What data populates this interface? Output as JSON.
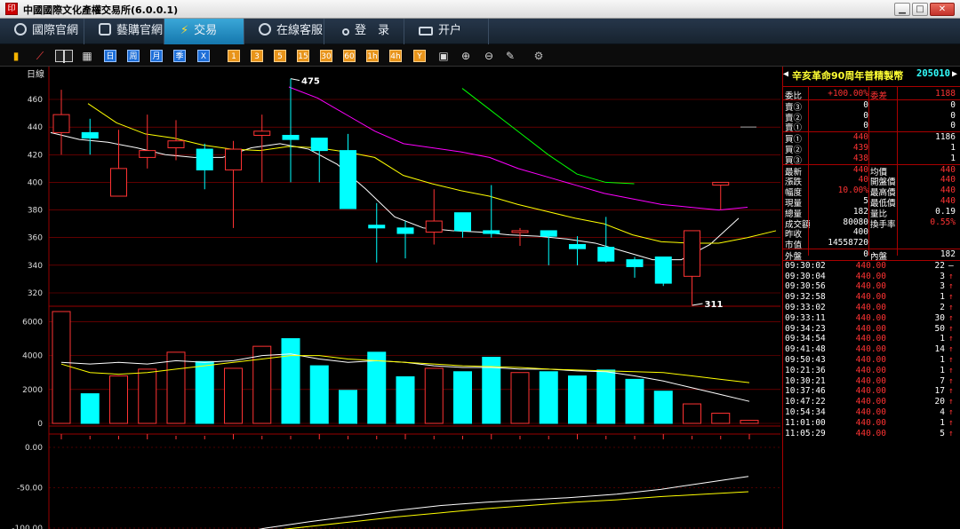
{
  "window": {
    "title": "中國國際文化產權交易所(6.0.0.1)",
    "app_icon": "seal-icon",
    "minimize": "▁",
    "maximize": "□",
    "close": "✕"
  },
  "nav": {
    "tabs": [
      {
        "label": "國際官網",
        "icon": "globe-icon"
      },
      {
        "label": "藝購官網",
        "icon": "link-icon"
      },
      {
        "label": "交易",
        "icon": "bolt-icon",
        "active": true
      },
      {
        "label": "在線客服",
        "icon": "chat-icon"
      },
      {
        "label": "登　录",
        "icon": "user-icon"
      },
      {
        "label": "开户",
        "icon": "card-icon"
      }
    ]
  },
  "toolbar": {
    "period_buttons": [
      "日",
      "周",
      "月",
      "季",
      "X"
    ],
    "minute_buttons": [
      "1",
      "3",
      "5",
      "15",
      "30",
      "60",
      "1h",
      "4h",
      "Y"
    ]
  },
  "chart": {
    "period_label": "日線",
    "colors": {
      "up": "#ff3333",
      "down": "#00ffff",
      "ma5": "#ffffff",
      "ma10": "#ffff00",
      "ma20": "#ff00ff",
      "ma60": "#00ff00",
      "grid": "#990000",
      "axis_text": "#dddddd"
    },
    "price_axis": [
      460,
      440,
      420,
      400,
      380,
      360,
      340,
      320
    ],
    "volume_axis": [
      6000,
      4000,
      2000,
      0
    ],
    "indicator_axis": [
      "0.00",
      "-50.00",
      "-100.00"
    ],
    "high_label": "475",
    "low_label": "311"
  },
  "chart_data": {
    "type": "candlestick",
    "ylim": [
      310,
      475
    ],
    "candles": [
      {
        "o": 436,
        "c": 449,
        "h": 467,
        "l": 420
      },
      {
        "o": 436,
        "c": 432,
        "h": 446,
        "l": 420
      },
      {
        "o": 390,
        "c": 410,
        "h": 438,
        "l": 390
      },
      {
        "o": 418,
        "c": 423,
        "h": 449,
        "l": 410
      },
      {
        "o": 425,
        "c": 430,
        "h": 445,
        "l": 416
      },
      {
        "o": 424,
        "c": 409,
        "h": 428,
        "l": 395
      },
      {
        "o": 409,
        "c": 424,
        "h": 430,
        "l": 367
      },
      {
        "o": 434,
        "c": 437,
        "h": 449,
        "l": 400
      },
      {
        "o": 434,
        "c": 431,
        "h": 475,
        "l": 400
      },
      {
        "o": 432,
        "c": 423,
        "h": 431,
        "l": 400
      },
      {
        "o": 423,
        "c": 381,
        "h": 435,
        "l": 381
      },
      {
        "o": 369,
        "c": 367,
        "h": 385,
        "l": 342
      },
      {
        "o": 367,
        "c": 363,
        "h": 372,
        "l": 345
      },
      {
        "o": 364,
        "c": 372,
        "h": 395,
        "l": 355
      },
      {
        "o": 378,
        "c": 365,
        "h": 376,
        "l": 360
      },
      {
        "o": 365,
        "c": 363,
        "h": 398,
        "l": 360
      },
      {
        "o": 364,
        "c": 365,
        "h": 367,
        "l": 354
      },
      {
        "o": 365,
        "c": 361,
        "h": 364,
        "l": 340
      },
      {
        "o": 355,
        "c": 352,
        "h": 361,
        "l": 340
      },
      {
        "o": 353,
        "c": 343,
        "h": 375,
        "l": 342
      },
      {
        "o": 344,
        "c": 339,
        "h": 346,
        "l": 331
      },
      {
        "o": 346,
        "c": 327,
        "h": 346,
        "l": 325
      },
      {
        "o": 332,
        "c": 365,
        "h": 365,
        "l": 311
      },
      {
        "o": 398,
        "c": 400,
        "h": 400,
        "l": 380
      }
    ],
    "volume": [
      6600,
      1750,
      2800,
      3200,
      4200,
      3650,
      3250,
      4550,
      5000,
      3400,
      1950,
      4200,
      2750,
      3250,
      3050,
      3900,
      3000,
      3050,
      2800,
      3150,
      2600,
      1900,
      1150,
      600,
      180
    ],
    "ma5": [
      436,
      431,
      429,
      425,
      420,
      418,
      418,
      425,
      428,
      424,
      413,
      395,
      375,
      367,
      365,
      364,
      362,
      361,
      359,
      356,
      350,
      344,
      344,
      355,
      374
    ],
    "ma10": [
      457,
      443,
      435,
      432,
      427,
      424,
      423,
      426,
      425,
      422,
      418,
      405,
      399,
      394,
      390,
      384,
      379,
      374,
      370,
      362,
      357,
      356,
      356,
      360,
      365
    ],
    "ma20": [
      469,
      461,
      449,
      437,
      428,
      425,
      422,
      418,
      410,
      404,
      398,
      392,
      388,
      384,
      382,
      380,
      382
    ],
    "ma60": [
      468,
      452,
      436,
      420,
      406,
      400,
      399
    ],
    "indicator_line_white": [
      -118,
      -110,
      -100,
      -92,
      -85,
      -78,
      -72,
      -68,
      -65,
      -62,
      -58,
      -52,
      -44,
      -36
    ],
    "indicator_line_yellow": [
      -118,
      -112,
      -104,
      -98,
      -92,
      -86,
      -81,
      -76,
      -72,
      -68,
      -65,
      -61,
      -58,
      -55
    ]
  },
  "quote": {
    "name": "辛亥革命90周年普精製幣",
    "code": "205010",
    "weibi_label": "委比",
    "weibi_value": "+100.00%",
    "weicha_label": "委差",
    "weicha_value": "1188",
    "sell": [
      {
        "label": "賣③",
        "price": "0",
        "vol": "0"
      },
      {
        "label": "賣②",
        "price": "0",
        "vol": "0"
      },
      {
        "label": "賣①",
        "price": "0",
        "vol": "0"
      }
    ],
    "buy": [
      {
        "label": "買①",
        "price": "440",
        "vol": "1186"
      },
      {
        "label": "買②",
        "price": "439",
        "vol": "1"
      },
      {
        "label": "買③",
        "price": "438",
        "vol": "1"
      }
    ],
    "stats": [
      {
        "l1": "最新",
        "v1": "440",
        "l2": "均價",
        "v2": "440"
      },
      {
        "l1": "漲跌",
        "v1": "40",
        "l2": "開盤價",
        "v2": "440"
      },
      {
        "l1": "幅度",
        "v1": "10.00%",
        "l2": "最高價",
        "v2": "440"
      },
      {
        "l1": "現量",
        "v1": "5",
        "l2": "最低價",
        "v2": "440"
      },
      {
        "l1": "總量",
        "v1": "182",
        "l2": "量比",
        "v2": "0.19"
      },
      {
        "l1": "成交額",
        "v1": "80080",
        "l2": "換手率",
        "v2": "0.55%"
      }
    ],
    "prev_close_label": "昨收",
    "prev_close": "400",
    "market_cap_label": "市值",
    "market_cap": "14558720",
    "outer_label": "外盤",
    "outer_value": "0",
    "inner_label": "內盤",
    "inner_value": "182",
    "ticks": [
      {
        "time": "09:30:02",
        "price": "440.00",
        "vol": "22",
        "dir": "—"
      },
      {
        "time": "09:30:04",
        "price": "440.00",
        "vol": "3",
        "dir": "↑"
      },
      {
        "time": "09:30:56",
        "price": "440.00",
        "vol": "3",
        "dir": "↑"
      },
      {
        "time": "09:32:58",
        "price": "440.00",
        "vol": "1",
        "dir": "↑"
      },
      {
        "time": "09:33:02",
        "price": "440.00",
        "vol": "2",
        "dir": "↑"
      },
      {
        "time": "09:33:11",
        "price": "440.00",
        "vol": "30",
        "dir": "↑"
      },
      {
        "time": "09:34:23",
        "price": "440.00",
        "vol": "50",
        "dir": "↑"
      },
      {
        "time": "09:34:54",
        "price": "440.00",
        "vol": "1",
        "dir": "↑"
      },
      {
        "time": "09:41:48",
        "price": "440.00",
        "vol": "14",
        "dir": "↑"
      },
      {
        "time": "09:50:43",
        "price": "440.00",
        "vol": "1",
        "dir": "↑"
      },
      {
        "time": "10:21:36",
        "price": "440.00",
        "vol": "1",
        "dir": "↑"
      },
      {
        "time": "10:30:21",
        "price": "440.00",
        "vol": "7",
        "dir": "↑"
      },
      {
        "time": "10:37:46",
        "price": "440.00",
        "vol": "17",
        "dir": "↑"
      },
      {
        "time": "10:47:22",
        "price": "440.00",
        "vol": "20",
        "dir": "↑"
      },
      {
        "time": "10:54:34",
        "price": "440.00",
        "vol": "4",
        "dir": "↑"
      },
      {
        "time": "11:01:00",
        "price": "440.00",
        "vol": "1",
        "dir": "↑"
      },
      {
        "time": "11:05:29",
        "price": "440.00",
        "vol": "5",
        "dir": "↑"
      }
    ]
  }
}
